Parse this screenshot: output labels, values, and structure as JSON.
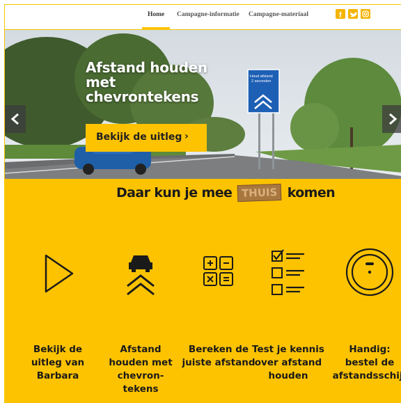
{
  "nav": {
    "items": [
      {
        "label": "Home"
      },
      {
        "label": "Campagne-informatie"
      },
      {
        "label": "Campagne-materiaal"
      }
    ],
    "social": [
      "facebook-icon",
      "twitter-icon",
      "instagram-icon"
    ]
  },
  "hero": {
    "title": "Afstand houden met chevrontekens",
    "button_label": "Bekijk de uitleg",
    "sign_text": "Houd afstand 2 seconden"
  },
  "section": {
    "headline_before": "Daar kun je mee",
    "headline_badge": "THUIS",
    "headline_after": "komen"
  },
  "features": [
    {
      "label": "Bekijk de uitleg van Barbara",
      "icon": "play-icon"
    },
    {
      "label": "Afstand houden met chevron-tekens",
      "icon": "car-chevron-icon"
    },
    {
      "label": "Bereken de juiste afstand",
      "icon": "calculator-icon"
    },
    {
      "label": "Test je kennis over afstand houden",
      "icon": "checklist-icon"
    },
    {
      "label": "Handig: bestel de afstandsschijf",
      "icon": "disc-icon"
    }
  ],
  "colors": {
    "accent": "#fec300",
    "text": "#1a1a1a"
  }
}
